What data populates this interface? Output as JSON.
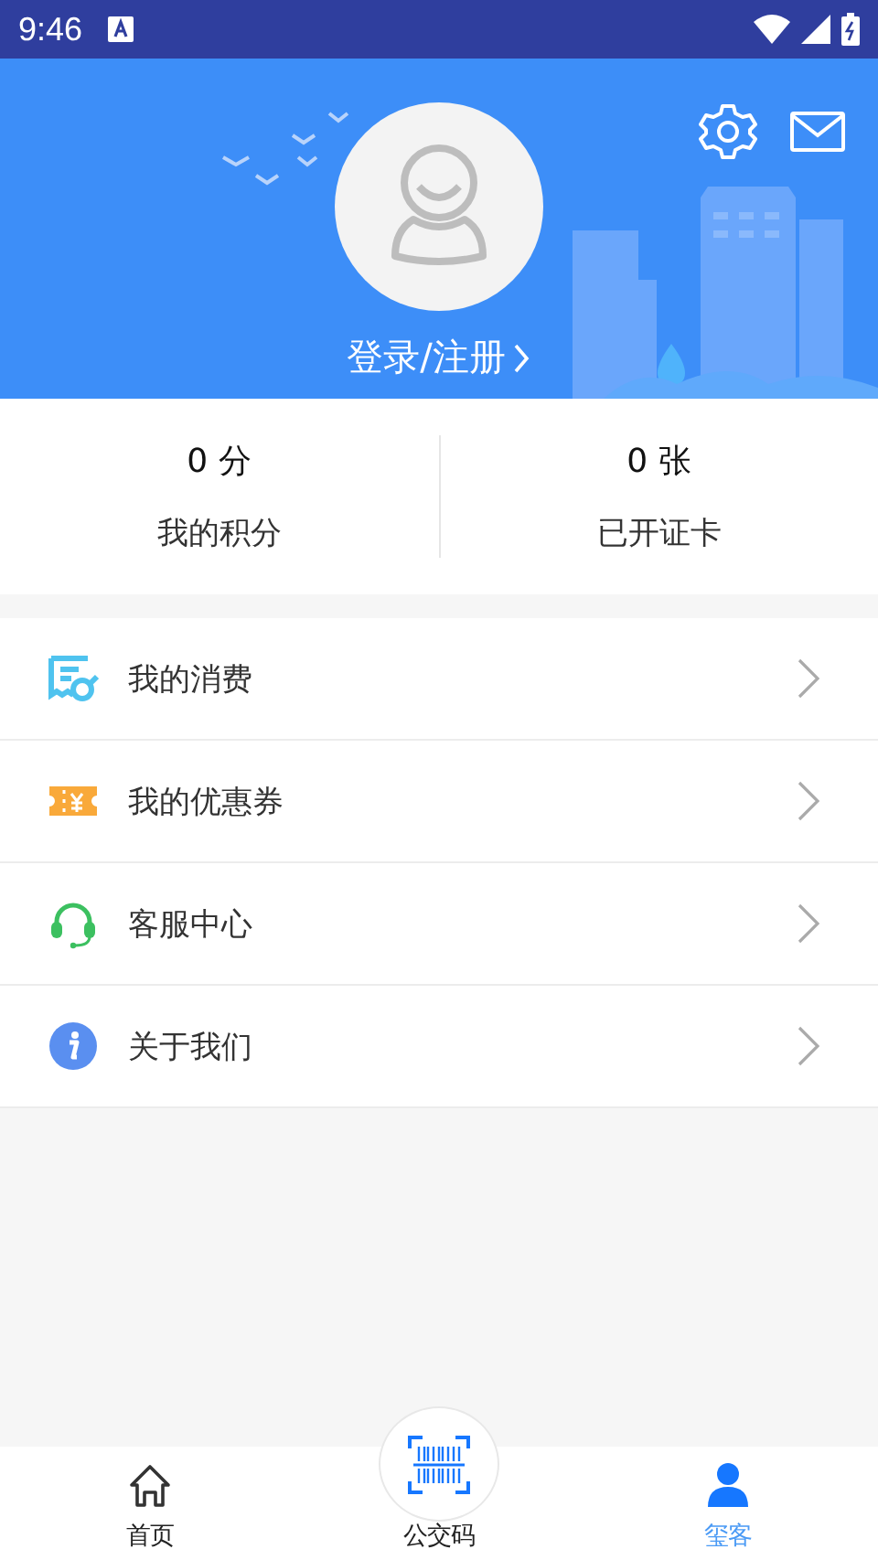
{
  "status_bar": {
    "time": "9:46"
  },
  "header": {
    "login_label": "登录/注册"
  },
  "stats": [
    {
      "value": "0 分",
      "label": "我的积分"
    },
    {
      "value": "0 张",
      "label": "已开证卡"
    }
  ],
  "menu": [
    {
      "kind": "receipt",
      "label": "我的消费"
    },
    {
      "kind": "coupon",
      "label": "我的优惠券"
    },
    {
      "kind": "headset",
      "label": "客服中心"
    },
    {
      "kind": "info",
      "label": "关于我们"
    }
  ],
  "nav": [
    {
      "kind": "home",
      "label": "首页",
      "selected": false
    },
    {
      "kind": "barcode",
      "label": "公交码",
      "selected": false
    },
    {
      "kind": "person",
      "label": "玺客",
      "selected": true
    }
  ]
}
